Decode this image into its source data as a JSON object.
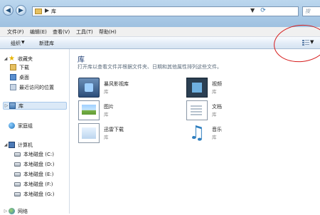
{
  "window": {
    "address_separator": "▶",
    "address_path": "库",
    "address_dropdown": "▼",
    "refresh_icon": "refresh-icon",
    "search_placeholder": "搜"
  },
  "menu": [
    "文件(F)",
    "编辑(E)",
    "查看(V)",
    "工具(T)",
    "帮助(H)"
  ],
  "toolbar": {
    "organize": "组织",
    "organize_caret": "▼",
    "new_library": "新建库",
    "view_caret": "▼"
  },
  "nav": {
    "favorites_label": "收藏夹",
    "favorites": [
      "下载",
      "桌面",
      "最近访问的位置"
    ],
    "library_label": "库",
    "homegroup_label": "家庭组",
    "computer_label": "计算机",
    "drives": [
      "本地磁盘 (C:)",
      "本地磁盘 (D:)",
      "本地磁盘 (E:)",
      "本地磁盘 (F:)",
      "本地磁盘 (G:)"
    ],
    "network_label": "网络"
  },
  "content": {
    "title": "库",
    "description": "打开库以查看文件并根据文件夹、日期和其他属性排列这些文件。",
    "libraries": [
      {
        "name": "暴风影视库",
        "sub": "库",
        "icon": "film-library-icon"
      },
      {
        "name": "视频",
        "sub": "库",
        "icon": "video-library-icon"
      },
      {
        "name": "图片",
        "sub": "库",
        "icon": "picture-library-icon"
      },
      {
        "name": "文档",
        "sub": "库",
        "icon": "document-library-icon"
      },
      {
        "name": "迅雷下载",
        "sub": "库",
        "icon": "download-library-icon"
      },
      {
        "name": "音乐",
        "sub": "库",
        "icon": "music-library-icon"
      }
    ]
  },
  "colors": {
    "annotation": "#d61c1c",
    "title_text": "#1e3d73",
    "selection": "#dbe9f7"
  }
}
